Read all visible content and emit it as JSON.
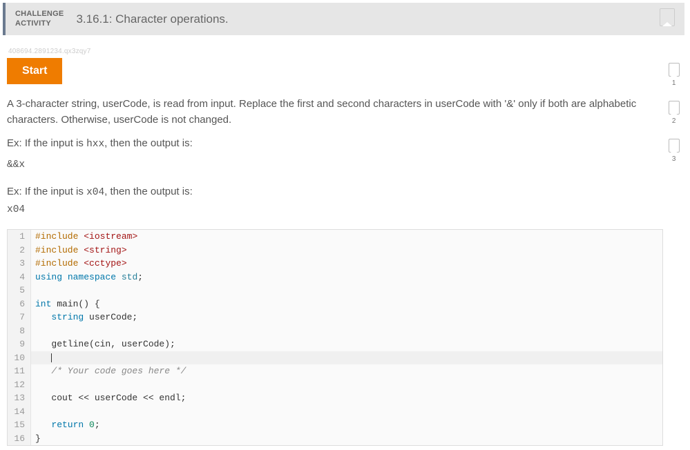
{
  "header": {
    "label_line1": "CHALLENGE",
    "label_line2": "ACTIVITY",
    "title": "3.16.1: Character operations."
  },
  "tracker_id": "408694.2891234.qx3zqy7",
  "start_button": "Start",
  "prompt": {
    "p1": "A 3-character string, userCode, is read from input. Replace the first and second characters in userCode with '&' only if both are alphabetic characters. Otherwise, userCode is not changed.",
    "ex1_lead": "Ex: If the input is ",
    "ex1_in": "hxx",
    "ex1_tail": ", then the output is:",
    "ex1_out": "&&x",
    "ex2_lead": "Ex: If the input is ",
    "ex2_in": "x04",
    "ex2_tail": ", then the output is:",
    "ex2_out": "x04"
  },
  "steps": [
    "1",
    "2",
    "3"
  ],
  "code": {
    "lines": [
      {
        "n": "1",
        "html": "<span class='tok-pre'>#include</span> <span class='tok-str'>&lt;iostream&gt;</span>"
      },
      {
        "n": "2",
        "html": "<span class='tok-pre'>#include</span> <span class='tok-str'>&lt;string&gt;</span>"
      },
      {
        "n": "3",
        "html": "<span class='tok-pre'>#include</span> <span class='tok-str'>&lt;cctype&gt;</span>"
      },
      {
        "n": "4",
        "html": "<span class='tok-kw'>using</span> <span class='tok-kw'>namespace</span> <span class='tok-ns'>std</span>;"
      },
      {
        "n": "5",
        "html": ""
      },
      {
        "n": "6",
        "html": "<span class='tok-type'>int</span> main() {"
      },
      {
        "n": "7",
        "html": "   <span class='tok-type'>string</span> userCode;"
      },
      {
        "n": "8",
        "html": ""
      },
      {
        "n": "9",
        "html": "   getline(cin, userCode);"
      },
      {
        "n": "10",
        "html": "   <span class='caret'></span>",
        "hl": true
      },
      {
        "n": "11",
        "html": "   <span class='tok-cmt'>/* Your code goes here */</span>"
      },
      {
        "n": "12",
        "html": ""
      },
      {
        "n": "13",
        "html": "   cout &lt;&lt; userCode &lt;&lt; endl;"
      },
      {
        "n": "14",
        "html": ""
      },
      {
        "n": "15",
        "html": "   <span class='tok-kw'>return</span> <span class='tok-num'>0</span>;"
      },
      {
        "n": "16",
        "html": "}"
      }
    ]
  }
}
